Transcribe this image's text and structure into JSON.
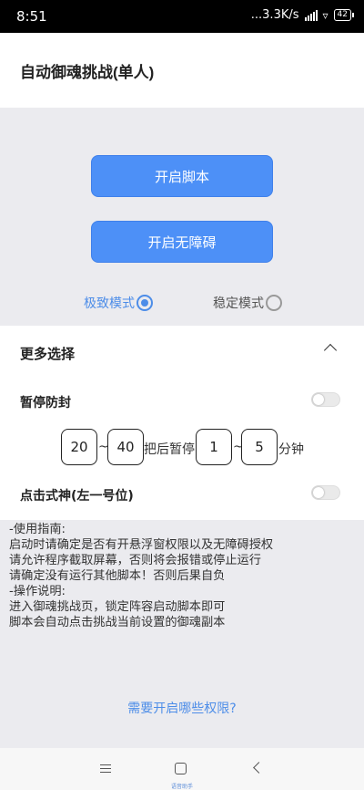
{
  "status": {
    "time": "8:51",
    "net_speed": "...3.3K/s",
    "battery": "42"
  },
  "header": {
    "title": "自动御魂挑战(单人)"
  },
  "buttons": {
    "start_script": "开启脚本",
    "enable_accessibility": "开启无障碍"
  },
  "modes": [
    {
      "label": "极致模式",
      "selected": true
    },
    {
      "label": "稳定模式",
      "selected": false
    }
  ],
  "more": {
    "title": "更多选择",
    "anti_ban": {
      "label": "暂停防封",
      "enabled": false
    },
    "range": {
      "from_min": "20",
      "from_max": "40",
      "text_pause": "把后暂停",
      "pause_min": "1",
      "pause_max": "5",
      "unit": "分钟",
      "tilde": "~"
    },
    "click_shikigami": {
      "label": "点击式神(左一号位)",
      "enabled": false
    }
  },
  "guide": {
    "lines": [
      "-使用指南:",
      "启动时请确定是否有开悬浮窗权限以及无障碍授权",
      "请允许程序截取屏幕，否则将会报错或停止运行",
      "请确定没有运行其他脚本！否则后果自负",
      "-操作说明:",
      "进入御魂挑战页，锁定阵容启动脚本即可",
      "脚本会自动点击挑战当前设置的御魂副本"
    ]
  },
  "permissions_link": "需要开启哪些权限?",
  "navbar": {
    "caption": "语音助手"
  },
  "colors": {
    "accent": "#4d90f7",
    "link": "#4d8de8"
  }
}
